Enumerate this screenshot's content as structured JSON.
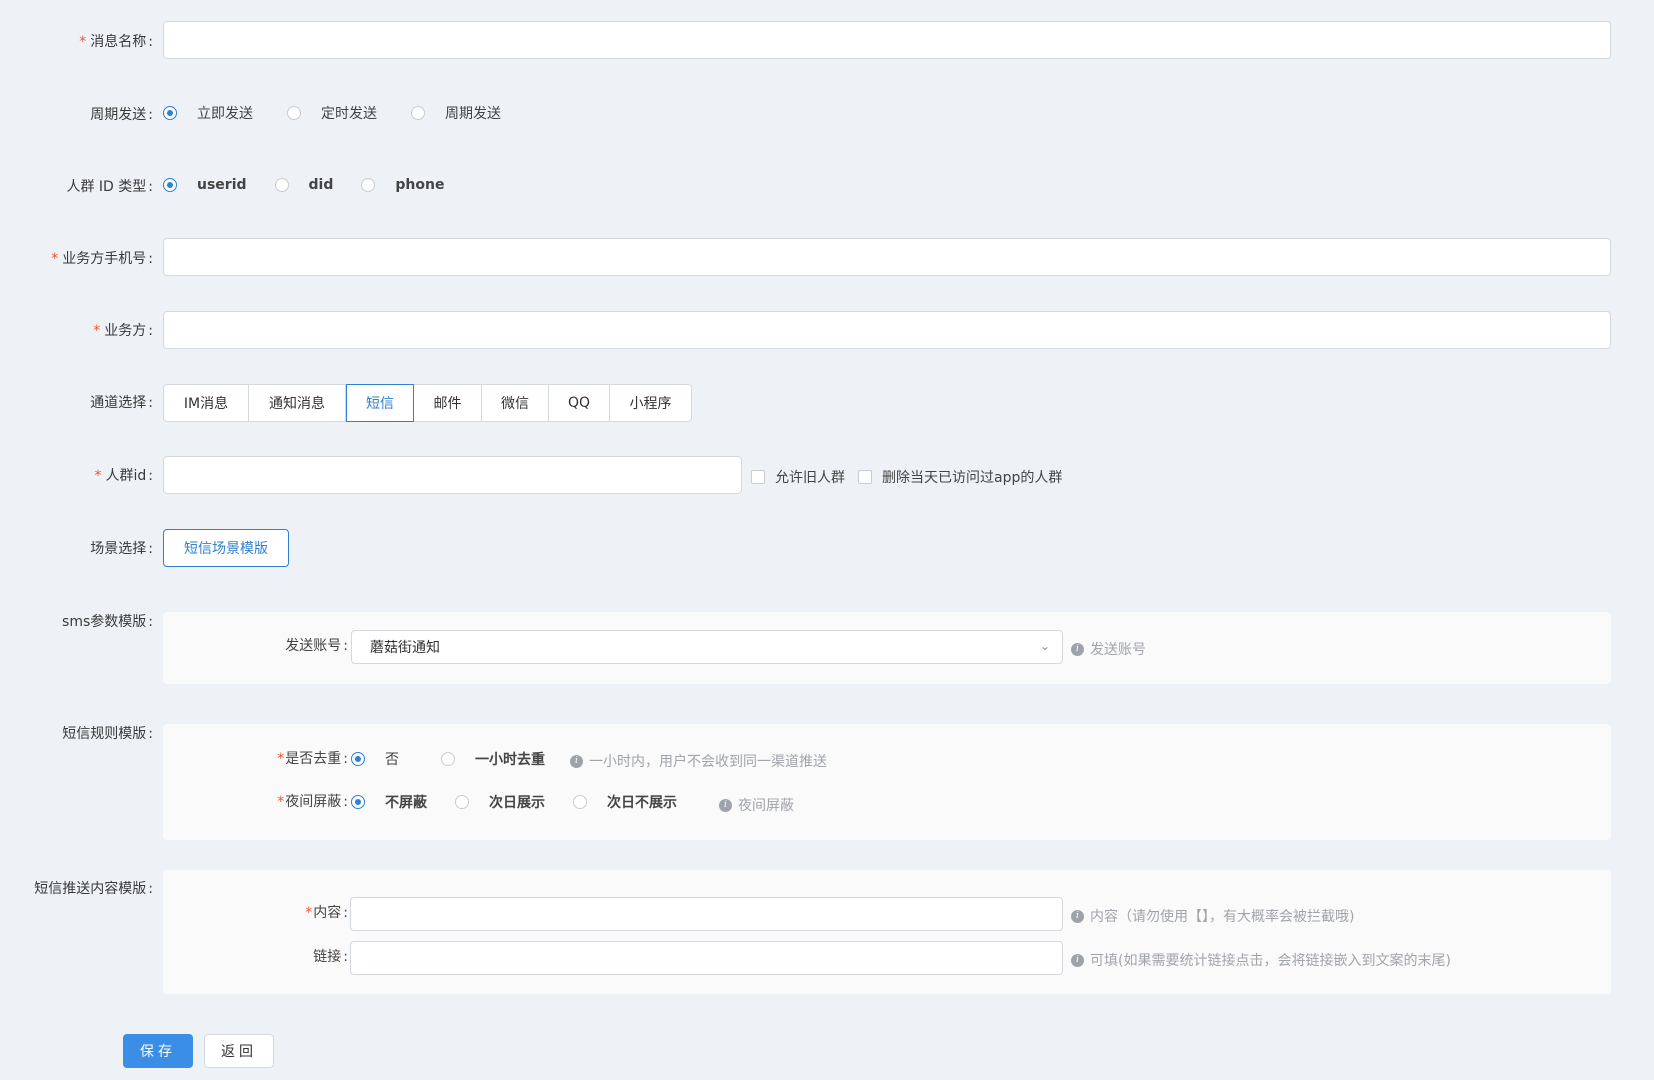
{
  "form": {
    "message_name": {
      "label": "消息名称",
      "required": true,
      "value": ""
    },
    "send_cycle": {
      "label": "周期发送",
      "options": [
        "立即发送",
        "定时发送",
        "周期发送"
      ],
      "selected": 0
    },
    "id_type": {
      "label": "人群 ID 类型",
      "options": [
        "userid",
        "did",
        "phone"
      ],
      "selected": 0
    },
    "biz_phone": {
      "label": "业务方手机号",
      "required": true,
      "value": ""
    },
    "biz_party": {
      "label": "业务方",
      "required": true,
      "value": ""
    },
    "channel": {
      "label": "通道选择",
      "options": [
        "IM消息",
        "通知消息",
        "短信",
        "邮件",
        "微信",
        "QQ",
        "小程序"
      ],
      "selected": 2
    },
    "crowd_id": {
      "label": "人群id",
      "required": true,
      "value": "",
      "allow_old_label": "允许旧人群",
      "remove_visited_label": "删除当天已访问过app的人群"
    },
    "scene": {
      "label": "场景选择",
      "button_label": "短信场景模版"
    },
    "sms_params": {
      "label": "sms参数模版",
      "account_label": "发送账号",
      "account_value": "蘑菇街通知",
      "account_hint": "发送账号"
    },
    "sms_rules": {
      "label": "短信规则模版",
      "dedup": {
        "label": "是否去重",
        "options": [
          "否",
          "一小时去重"
        ],
        "selected": 0,
        "hint": "一小时内，用户不会收到同一渠道推送"
      },
      "night": {
        "label": "夜间屏蔽",
        "options": [
          "不屏蔽",
          "次日展示",
          "次日不展示"
        ],
        "selected": 0,
        "hint": "夜间屏蔽"
      }
    },
    "sms_content": {
      "label": "短信推送内容模版",
      "content_label": "内容",
      "content_value": "",
      "content_hint": "内容（请勿使用【】，有大概率会被拦截哦)",
      "link_label": "链接",
      "link_value": "",
      "link_hint": "可填(如果需要统计链接点击，会将链接嵌入到文案的末尾)"
    }
  },
  "actions": {
    "save": "保存",
    "back": "返回"
  },
  "colors": {
    "primary": "#3a8ee6",
    "required": "#e4572e",
    "background": "#eef1f6"
  }
}
